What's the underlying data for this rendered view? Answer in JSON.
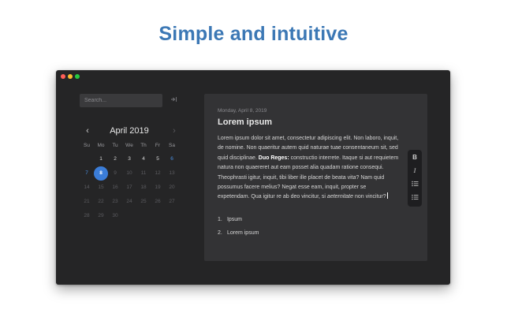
{
  "headline": "Simple and intuitive",
  "sidebar": {
    "search_placeholder": "Search...",
    "collapse_icon": "sidebar-collapse-icon"
  },
  "calendar": {
    "month_title": "April 2019",
    "weekdays": [
      "Su",
      "Mo",
      "Tu",
      "We",
      "Th",
      "Fr",
      "Sa"
    ],
    "weeks": [
      [
        "",
        "1",
        "2",
        "3",
        "4",
        "5",
        "6"
      ],
      [
        "7",
        "8",
        "9",
        "10",
        "11",
        "12",
        "13"
      ],
      [
        "14",
        "15",
        "16",
        "17",
        "18",
        "19",
        "20"
      ],
      [
        "21",
        "22",
        "23",
        "24",
        "25",
        "26",
        "27"
      ],
      [
        "28",
        "29",
        "30",
        "",
        "",
        "",
        ""
      ]
    ],
    "selected_day": "8",
    "accent_color": "#3b7dd8",
    "weekend_color": "#4a90e2"
  },
  "editor": {
    "date": "Monday, April 8, 2019",
    "title": "Lorem ipsum",
    "body_part1": "Lorem ipsum dolor sit amet, consectetur adipiscing elit. Non laboro, inquit, de nomine. Non quaeritur autem quid naturae tuae consentaneum sit, sed quid disciplinae. ",
    "body_bold": "Duo Reges:",
    "body_part2": " constructio interrete. Itaque si aut requietem natura non quaereret aut eam posset alia quadam ratione consequi. Theophrasti igitur, inquit, tibi liber ille placet de beata vita? Nam quid possumus facere melius? Negat esse eam, inquit, propter se expetendam. Qua igitur re ab deo vincitur, si ",
    "body_italic": "aeternitate",
    "body_part3": " non vincitur?",
    "list": [
      {
        "num": "1.",
        "text": "Ipsum"
      },
      {
        "num": "2.",
        "text": "Lorem ipsum"
      }
    ]
  },
  "format_bar": {
    "bold_label": "B",
    "italic_label": "I"
  }
}
